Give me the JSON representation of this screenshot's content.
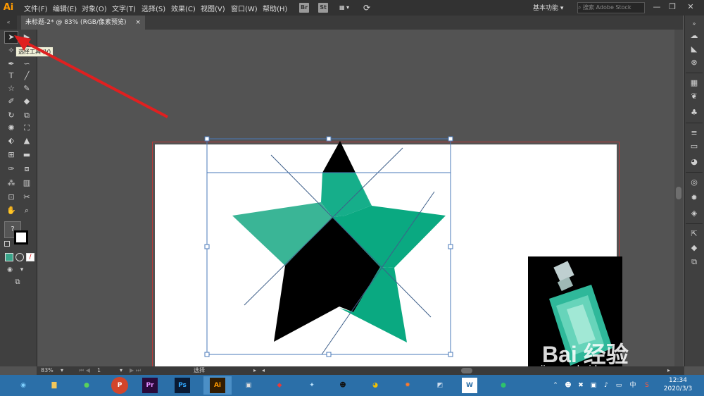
{
  "app": {
    "logo": "Ai",
    "accent": "#ff9a00"
  },
  "menu": [
    "文件(F)",
    "编辑(E)",
    "对象(O)",
    "文字(T)",
    "选择(S)",
    "效果(C)",
    "视图(V)",
    "窗口(W)",
    "帮助(H)"
  ],
  "menubar_badges": {
    "bridge": "Br",
    "stock": "St"
  },
  "workspace": {
    "label": "基本功能",
    "search_placeholder": "搜索 Adobe Stock"
  },
  "window_controls": {
    "minimize": "—",
    "restore": "❐",
    "close": "✕"
  },
  "document_tab": {
    "title": "未标题-2* @ 83% (RGB/像素预览)",
    "close": "×"
  },
  "toolbar": {
    "tooltip": "选择工具 (V)",
    "unknown_swatch": "?",
    "fill_color": "#3aa58a"
  },
  "artwork": {
    "star_colors": {
      "light": "#3ab596",
      "mid": "#0aa981",
      "dark": "#000000"
    }
  },
  "status_bar": {
    "zoom": "83%",
    "page": "1",
    "tool": "选择"
  },
  "watermark": {
    "brand": "Bai 经验",
    "url": "jingyan.baidu.com"
  },
  "taskbar": {
    "apps": [
      {
        "name": "browser-360",
        "label": ""
      },
      {
        "name": "file-explorer",
        "label": ""
      },
      {
        "name": "wechat",
        "label": ""
      },
      {
        "name": "powerpoint",
        "label": "P"
      },
      {
        "name": "premiere",
        "label": "Pr"
      },
      {
        "name": "photoshop",
        "label": "Ps"
      },
      {
        "name": "illustrator",
        "label": "Ai"
      },
      {
        "name": "video-editor",
        "label": ""
      },
      {
        "name": "app-red",
        "label": ""
      },
      {
        "name": "app-bird",
        "label": ""
      },
      {
        "name": "qq",
        "label": ""
      },
      {
        "name": "chrome",
        "label": ""
      },
      {
        "name": "app-orange",
        "label": ""
      },
      {
        "name": "app-blue",
        "label": ""
      },
      {
        "name": "wps",
        "label": "W"
      },
      {
        "name": "app-green",
        "label": ""
      }
    ],
    "time": "12:34",
    "date": "2020/3/3"
  }
}
